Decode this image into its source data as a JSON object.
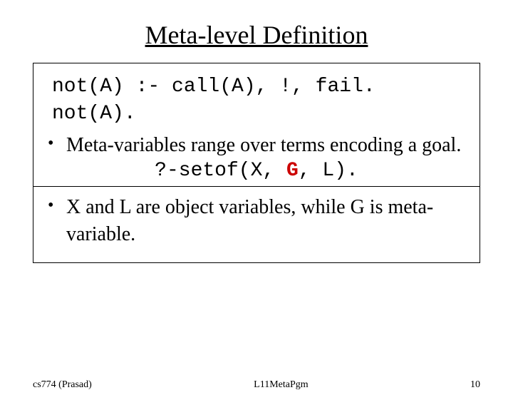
{
  "title": "Meta-level Definition",
  "code": {
    "line1": "not(A) :- call(A), !, fail.",
    "line2": "not(A)."
  },
  "bullets": {
    "b1": "Meta-variables range over terms encoding a goal.",
    "b2": "X and L are object variables, while G is meta-variable."
  },
  "setof": {
    "prefix": "?-setof(X, ",
    "g": "G",
    "suffix": ", L)."
  },
  "footer": {
    "left": "cs774 (Prasad)",
    "center": "L11MetaPgm",
    "right": "10"
  }
}
